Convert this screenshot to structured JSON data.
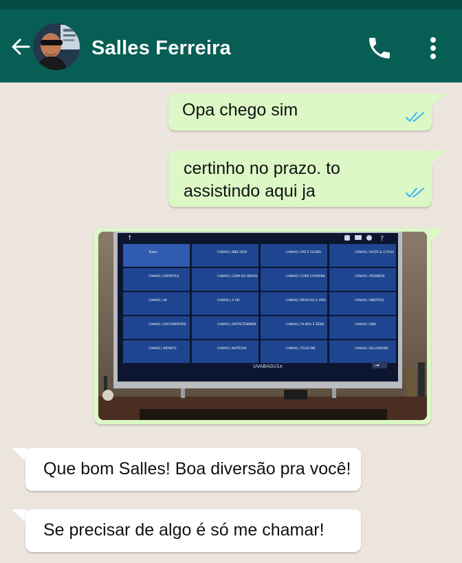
{
  "header": {
    "contact_name": "Salles Ferreira",
    "back_icon": "arrow-left-icon",
    "call_icon": "phone-icon",
    "menu_icon": "more-vertical-icon",
    "color": "#075e54"
  },
  "messages": [
    {
      "direction": "outgoing",
      "text": "Opa chego sim",
      "status": "read"
    },
    {
      "direction": "outgoing",
      "lines": [
        "certinho no prazo. to",
        "assistindo aqui ja"
      ],
      "status": "read"
    },
    {
      "direction": "outgoing",
      "type": "image",
      "image": {
        "tv_bottom_label": "UVABAGU1e",
        "tiles": [
          "Todos",
          "CANAIS | BBB 2020",
          "CANAIS | FAZ É GLOBO",
          "CANAIS | SALTE & G PLUS",
          "CANAIS | ESPORTES",
          "CANAIS | COPA DO BRASIL",
          "CANAIS | COPA CATARINA",
          "CANAIS | PREMIERE",
          "CANAIS | 4K",
          "CANAIS | 4 HD",
          "CANAIS | MÚSICAS E VÁRI",
          "CANAIS | ABERTOS",
          "CANAIS | DOCUMENTÁRI",
          "CANAIS | ENTRETENIMEN",
          "CANAIS | FILMES E SÉRIE",
          "CANAIS | HBO",
          "CANAIS | INFANTIL",
          "CANAIS | NOTÍCIAS",
          "CANAIS | TELECINE",
          "CANAIS | RELAXDORE"
        ]
      },
      "status": "read"
    },
    {
      "direction": "incoming",
      "text": "Que bom Salles! Boa diversão pra você!"
    },
    {
      "direction": "incoming",
      "text": "Se precisar de algo é só me chamar!"
    }
  ],
  "colors": {
    "outgoing_bubble": "#dcf8c6",
    "incoming_bubble": "#ffffff",
    "read_ticks": "#34b7f1",
    "background": "#ece5dd"
  }
}
